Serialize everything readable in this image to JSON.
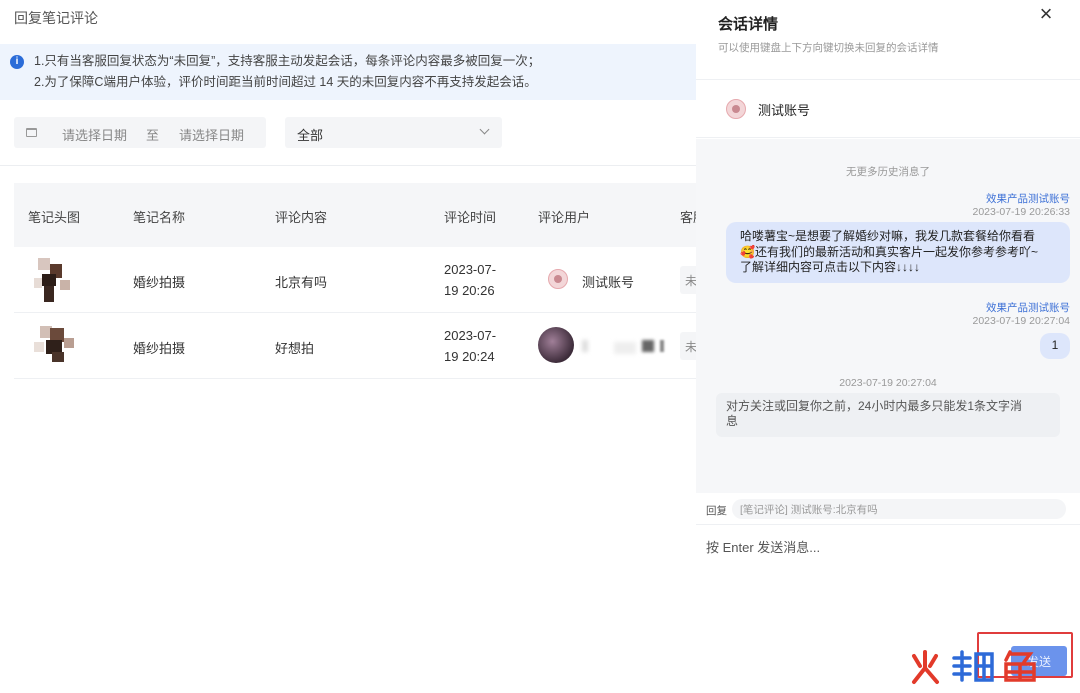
{
  "page": {
    "title": "回复笔记评论",
    "notice": {
      "line1": "1.只有当客服回复状态为“未回复”，支持客服主动发起会话，每条评论内容最多被回复一次；",
      "line2": "2.为了保障C端用户体验，评价时间距当前时间超过 14 天的未回复内容不再支持发起会话。"
    },
    "filters": {
      "start_placeholder": "请选择日期",
      "separator": "至",
      "end_placeholder": "请选择日期",
      "status_value": "全部"
    },
    "table": {
      "headers": [
        "笔记头图",
        "笔记名称",
        "评论内容",
        "评论时间",
        "评论用户",
        "客服"
      ],
      "rows": [
        {
          "note_name": "婚纱拍摄",
          "comment": "北京有吗",
          "time_date": "2023-07-",
          "time_clock": "19 20:26",
          "user": "测试账号",
          "chip": "未"
        },
        {
          "note_name": "婚纱拍摄",
          "comment": "好想拍",
          "time_date": "2023-07-",
          "time_clock": "19 20:24",
          "user": "",
          "chip": "未"
        }
      ]
    }
  },
  "drawer": {
    "title": "会话详情",
    "subtitle": "可以使用键盘上下方向键切换未回复的会话详情",
    "close_icon": "×",
    "contact_name": "测试账号",
    "no_history": "无更多历史消息了",
    "messages": [
      {
        "sender": "效果产品测试账号",
        "time": "2023-07-19 20:26:33",
        "line1": "哈喽薯宝~是想要了解婚纱对嘛，我发几款套餐给你看看",
        "line2": "🥰还有我们的最新活动和真实客片一起发你参考参考吖~",
        "line3": "了解详细内容可点击以下内容↓↓↓↓"
      },
      {
        "sender": "效果产品测试账号",
        "time": "2023-07-19 20:27:04",
        "text": "1"
      }
    ],
    "system_time": "2023-07-19 20:27:04",
    "system_line1": "对方关注或回复你之前，24小时内最多只能发1条文字消",
    "system_line2": "息",
    "reply_label": "回复",
    "reply_quote": "[笔记评论] 测试账号:北京有吗",
    "input_placeholder": "按 Enter 发送消息...",
    "send_label": "发送"
  },
  "colors": {
    "accent": "#3b6fd6",
    "bubble": "#dde6fb",
    "send_button": "#6b93ec",
    "highlight_box": "#e03c3c",
    "watermark_red": "#e23a2a",
    "watermark_blue": "#2d6ad8"
  },
  "watermark": "火鲤鱼"
}
